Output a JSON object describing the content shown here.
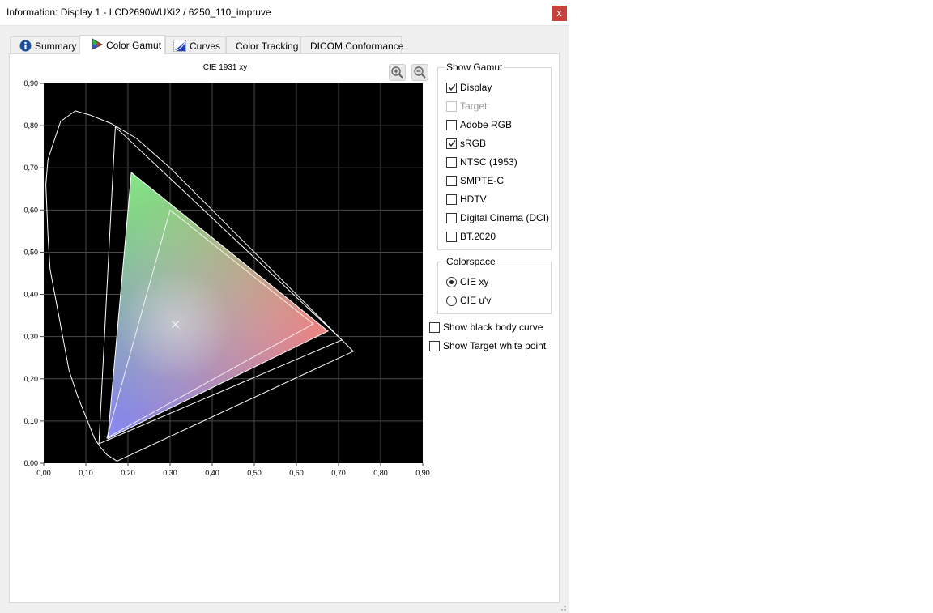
{
  "window": {
    "title": "Information: Display 1 - LCD2690WUXi2 / 6250_110_impruve",
    "close_label": "x"
  },
  "tabs": [
    {
      "label": "Summary",
      "icon": "info-icon",
      "active": false
    },
    {
      "label": "Color Gamut",
      "icon": "color-gamut-icon",
      "active": true
    },
    {
      "label": "Curves",
      "icon": "curves-icon",
      "active": false
    },
    {
      "label": "Color Tracking",
      "icon": "",
      "active": false
    },
    {
      "label": "DICOM Conformance",
      "icon": "",
      "active": false
    }
  ],
  "chart_data": {
    "type": "scatter",
    "title": "CIE 1931 xy",
    "xlabel": "",
    "ylabel": "",
    "xlim": [
      0,
      0.9
    ],
    "ylim": [
      0,
      0.9
    ],
    "grid": true,
    "background": "#000000",
    "x_ticks": [
      "0,00",
      "0,10",
      "0,20",
      "0,30",
      "0,40",
      "0,50",
      "0,60",
      "0,70",
      "0,80",
      "0,90"
    ],
    "y_ticks": [
      "0,00",
      "0,10",
      "0,20",
      "0,30",
      "0,40",
      "0,50",
      "0,60",
      "0,70",
      "0,80",
      "0,90"
    ],
    "spectral_locus": [
      [
        0.174,
        0.005
      ],
      [
        0.15,
        0.02
      ],
      [
        0.133,
        0.04
      ],
      [
        0.12,
        0.06
      ],
      [
        0.1,
        0.11
      ],
      [
        0.08,
        0.16
      ],
      [
        0.06,
        0.22
      ],
      [
        0.045,
        0.3
      ],
      [
        0.03,
        0.38
      ],
      [
        0.015,
        0.46
      ],
      [
        0.01,
        0.54
      ],
      [
        0.005,
        0.66
      ],
      [
        0.01,
        0.72
      ],
      [
        0.02,
        0.75
      ],
      [
        0.04,
        0.81
      ],
      [
        0.075,
        0.835
      ],
      [
        0.11,
        0.825
      ],
      [
        0.16,
        0.805
      ],
      [
        0.22,
        0.77
      ],
      [
        0.3,
        0.7
      ],
      [
        0.4,
        0.6
      ],
      [
        0.5,
        0.5
      ],
      [
        0.6,
        0.4
      ],
      [
        0.7,
        0.3
      ],
      [
        0.735,
        0.265
      ],
      [
        0.174,
        0.005
      ]
    ],
    "series": [
      {
        "name": "Display",
        "points": [
          [
            0.675,
            0.313
          ],
          [
            0.208,
            0.689
          ],
          [
            0.152,
            0.058
          ]
        ]
      },
      {
        "name": "sRGB",
        "points": [
          [
            0.64,
            0.33
          ],
          [
            0.3,
            0.6
          ],
          [
            0.15,
            0.06
          ]
        ]
      },
      {
        "name": "BT.2020",
        "points": [
          [
            0.708,
            0.292
          ],
          [
            0.17,
            0.797
          ],
          [
            0.131,
            0.046
          ]
        ]
      }
    ],
    "white_point": [
      0.3127,
      0.329
    ]
  },
  "show_gamut": {
    "title": "Show Gamut",
    "items": [
      {
        "label": "Display",
        "checked": true,
        "enabled": true
      },
      {
        "label": "Target",
        "checked": false,
        "enabled": false
      },
      {
        "label": "Adobe RGB",
        "checked": false,
        "enabled": true
      },
      {
        "label": "sRGB",
        "checked": true,
        "enabled": true
      },
      {
        "label": "NTSC (1953)",
        "checked": false,
        "enabled": true
      },
      {
        "label": "SMPTE-C",
        "checked": false,
        "enabled": true
      },
      {
        "label": "HDTV",
        "checked": false,
        "enabled": true
      },
      {
        "label": "Digital Cinema (DCI)",
        "checked": false,
        "enabled": true
      },
      {
        "label": "BT.2020",
        "checked": false,
        "enabled": true
      }
    ]
  },
  "colorspace": {
    "title": "Colorspace",
    "options": [
      {
        "label": "CIE xy",
        "selected": true
      },
      {
        "label": "CIE u'v'",
        "selected": false
      }
    ]
  },
  "options": [
    {
      "label": "Show black body curve",
      "checked": false
    },
    {
      "label": "Show Target white point",
      "checked": false
    }
  ]
}
